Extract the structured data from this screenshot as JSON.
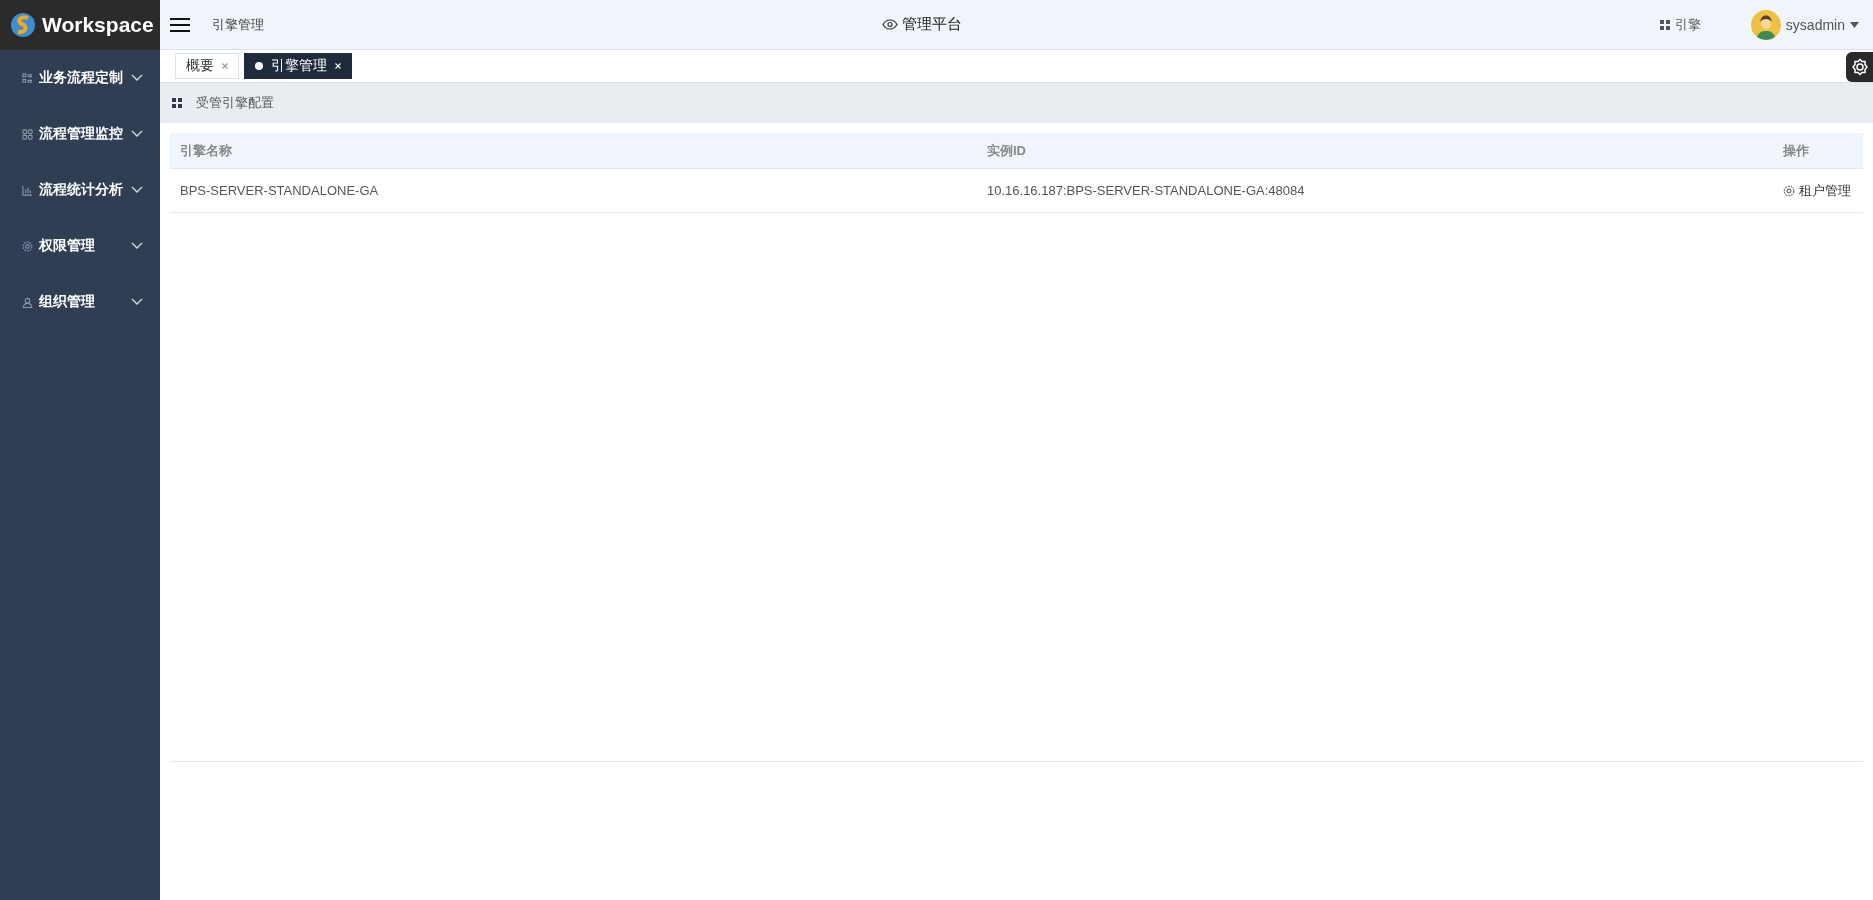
{
  "logo": {
    "text": "Workspace"
  },
  "sidebar": {
    "items": [
      {
        "label": "业务流程定制",
        "kind": "list",
        "expanded": false
      },
      {
        "label": "流程管理监控",
        "kind": "grid",
        "expanded": false
      },
      {
        "label": "流程统计分析",
        "kind": "chart",
        "expanded": false
      },
      {
        "label": "权限管理",
        "kind": "gear",
        "expanded": false
      },
      {
        "label": "组织管理",
        "kind": "user",
        "expanded": false
      }
    ]
  },
  "header": {
    "breadcrumb": "引擎管理",
    "title": "管理平台",
    "engine_link": "引擎",
    "user": "sysadmin"
  },
  "tabs": [
    {
      "label": "概要",
      "selected": false
    },
    {
      "label": "引擎管理",
      "selected": true
    }
  ],
  "section_title": "受管引擎配置",
  "table": {
    "columns": [
      "引擎名称",
      "实例ID",
      "操作"
    ],
    "rows": [
      {
        "cells": [
          "BPS-SERVER-STANDALONE-GA",
          "10.16.16.187:BPS-SERVER-STANDALONE-GA:48084"
        ],
        "action": "租户管理"
      }
    ]
  }
}
